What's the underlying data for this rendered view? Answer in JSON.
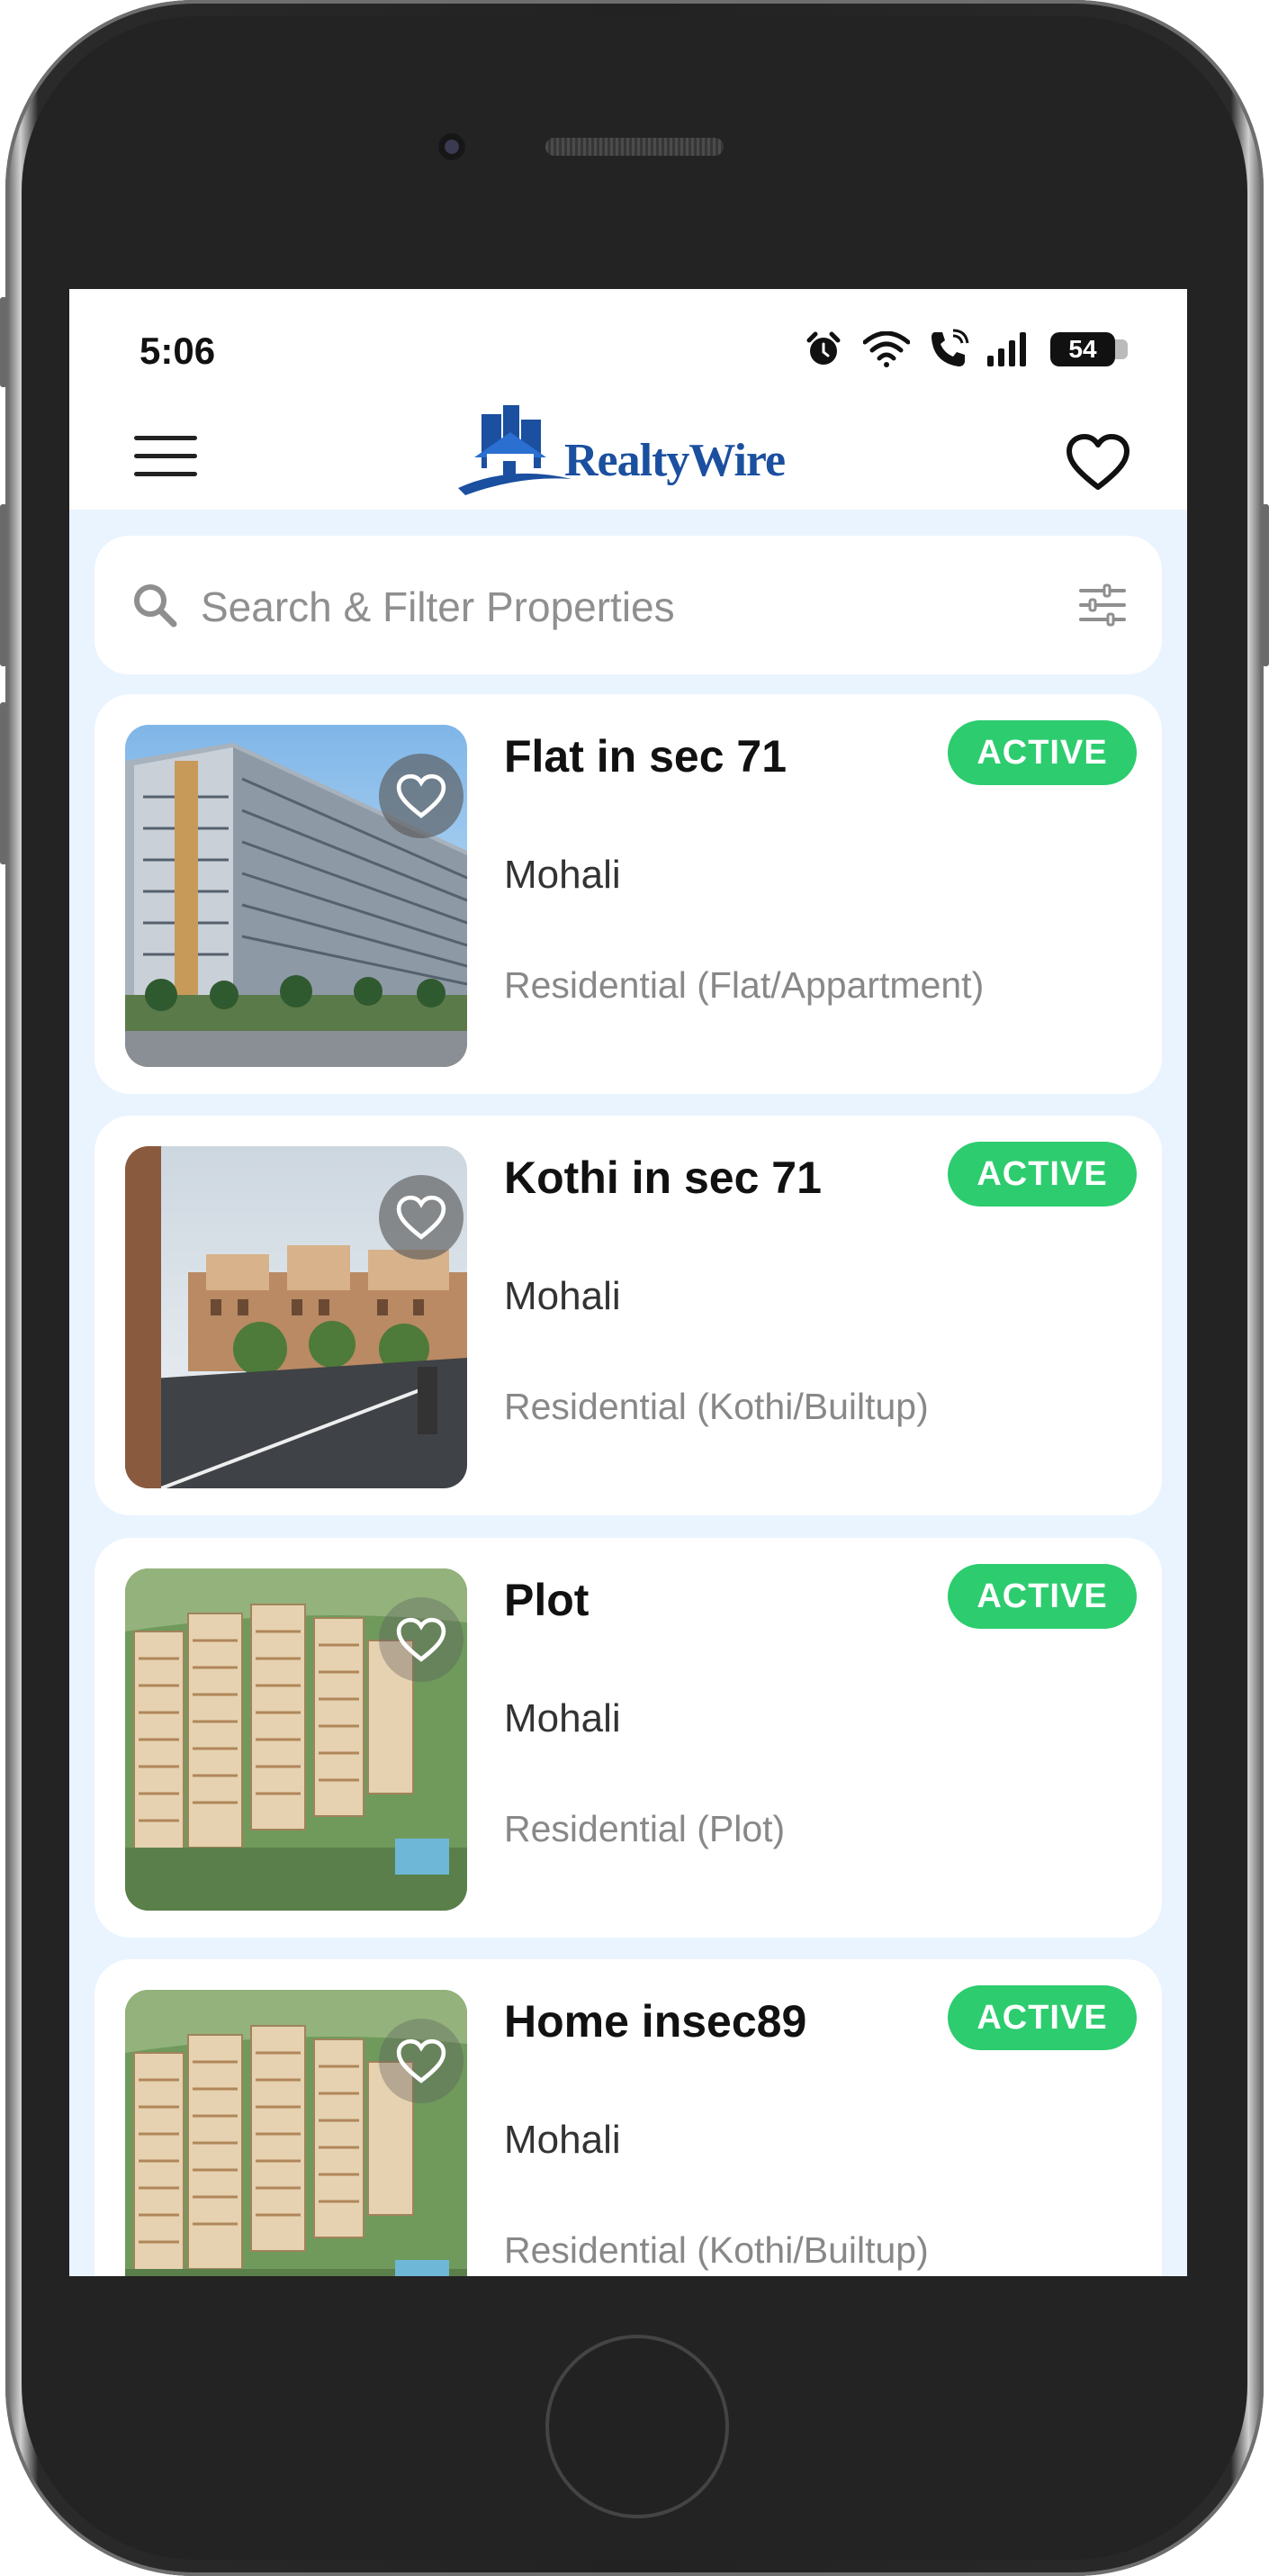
{
  "status_bar": {
    "time": "5:06",
    "battery": "54",
    "icons": [
      "alarm-icon",
      "wifi-icon",
      "wifi-call-icon",
      "signal-icon",
      "battery-icon"
    ]
  },
  "app_bar": {
    "logo_text": "RealtyWire",
    "menu_icon": "hamburger-menu-icon",
    "favorites_icon": "heart-outline-icon"
  },
  "search": {
    "placeholder": "Search & Filter Properties",
    "search_icon": "search-icon",
    "filter_icon": "sliders-icon"
  },
  "colors": {
    "active": "#2dcc6f",
    "brand": "#1b4f9f",
    "background": "#eaf4ff"
  },
  "listings": [
    {
      "title": "Flat in sec 71",
      "status": "ACTIVE",
      "location": "Mohali",
      "type": "Residential (Flat/Appartment)",
      "image": "high-rise-apartment-photo"
    },
    {
      "title": "Kothi in sec 71",
      "status": "ACTIVE",
      "location": "Mohali",
      "type": "Residential (Kothi/Builtup)",
      "image": "street-townhouses-photo"
    },
    {
      "title": "Plot",
      "status": "ACTIVE",
      "location": "Mohali",
      "type": "Residential (Plot)",
      "image": "tower-complex-aerial-photo"
    },
    {
      "title": "Home insec89",
      "status": "ACTIVE",
      "location": "Mohali",
      "type": "Residential (Kothi/Builtup)",
      "image": "tower-complex-aerial-photo"
    }
  ]
}
